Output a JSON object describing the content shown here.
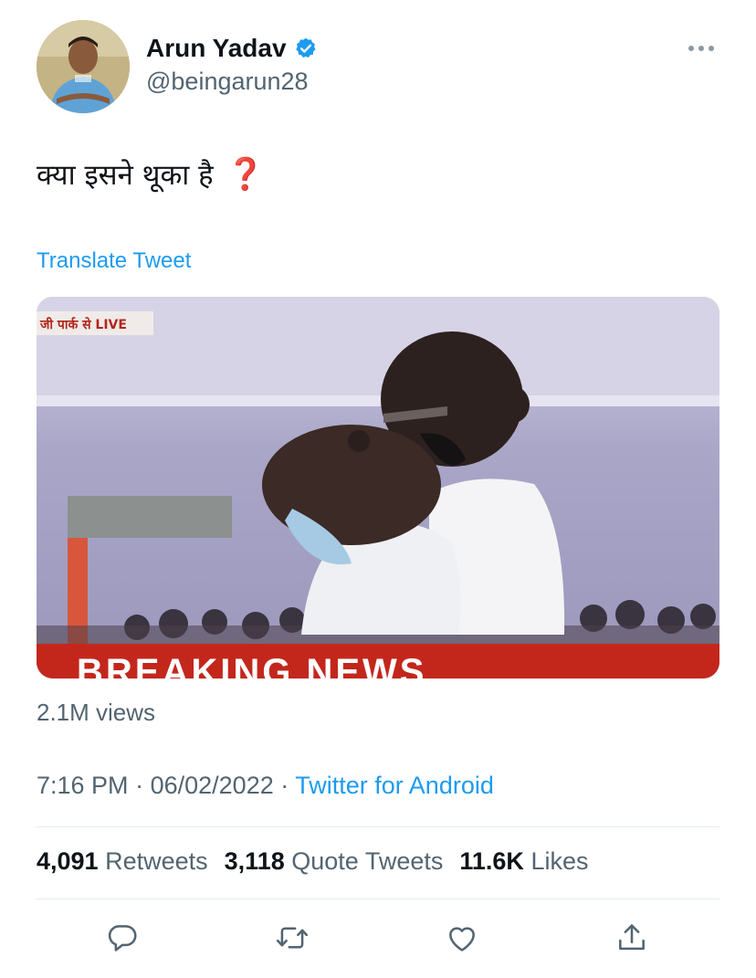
{
  "author": {
    "display_name": "Arun Yadav",
    "handle": "@beingarun28",
    "verified": true,
    "avatar_icon": "profile-photo"
  },
  "tweet": {
    "text": "क्या इसने थूका है",
    "emoji": "❓",
    "translate_label": "Translate Tweet"
  },
  "media": {
    "channel_tag": "जी पार्क से LIVE",
    "banner_text": "BREAKING NEWS",
    "banner_color": "#c3271c"
  },
  "views": "2.1M views",
  "meta": {
    "time": "7:16 PM",
    "separator": "·",
    "date": "06/02/2022",
    "source": "Twitter for Android"
  },
  "stats": [
    {
      "count": "4,091",
      "label": "Retweets"
    },
    {
      "count": "3,118",
      "label": "Quote Tweets"
    },
    {
      "count": "11.6K",
      "label": "Likes"
    }
  ],
  "actions": [
    "reply-icon",
    "retweet-icon",
    "like-icon",
    "share-icon"
  ],
  "colors": {
    "accent": "#1d9bf0",
    "secondary_text": "#536471",
    "primary_text": "#0f1419"
  }
}
